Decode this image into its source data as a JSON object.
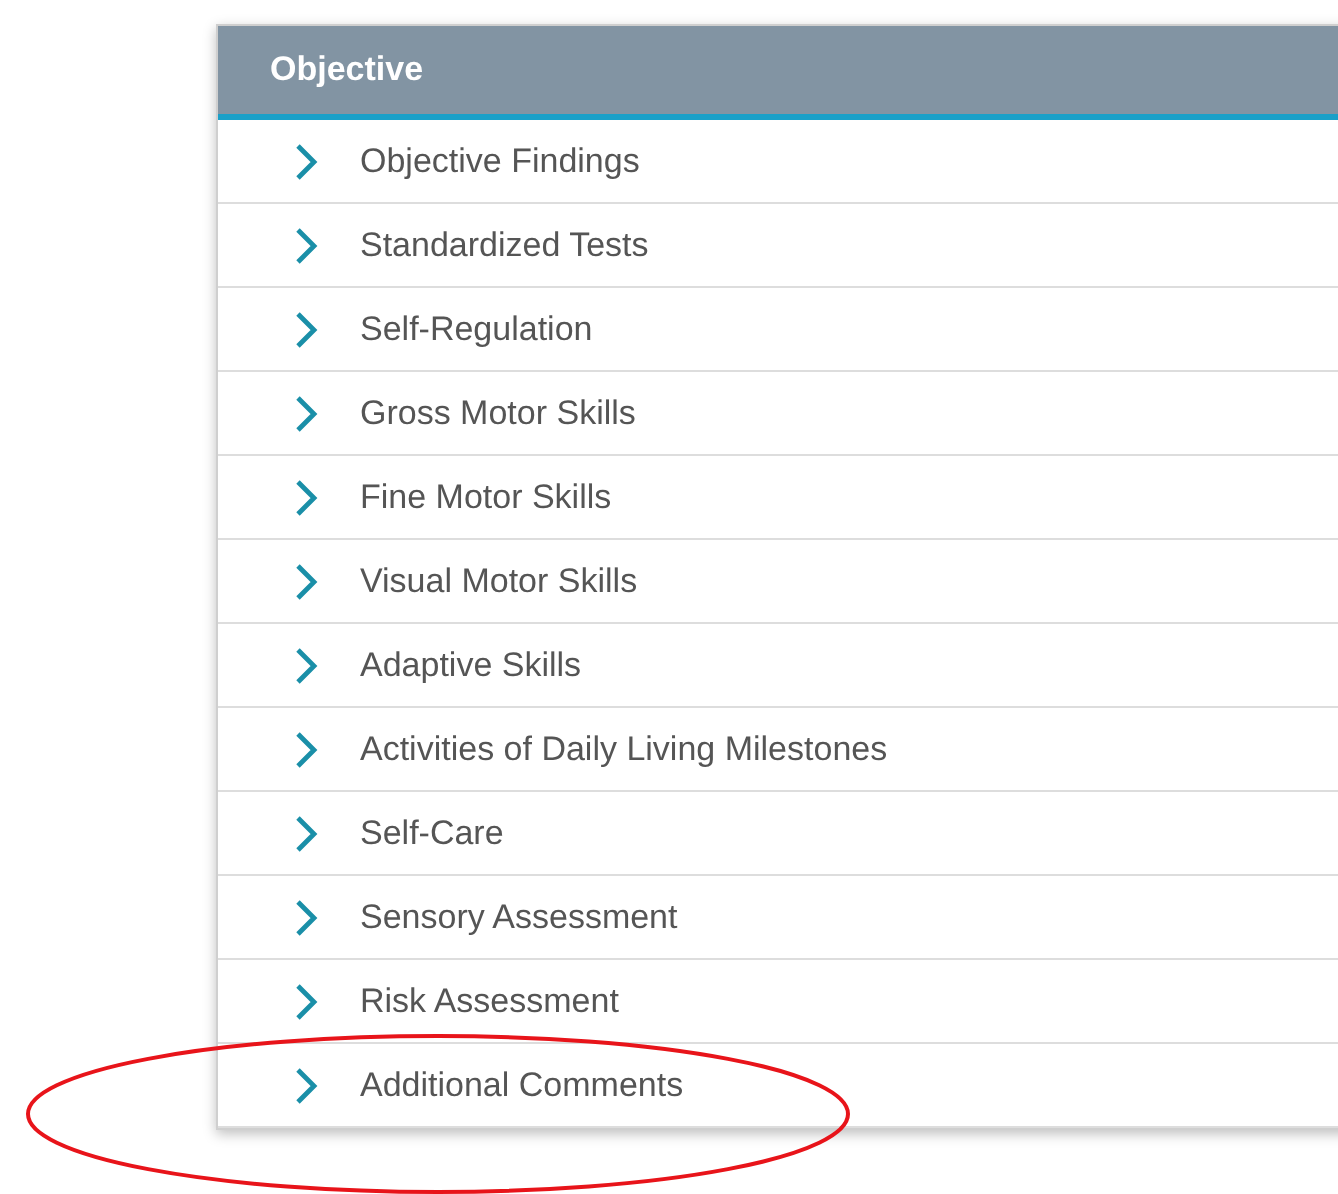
{
  "panel": {
    "title": "Objective",
    "items": [
      {
        "label": "Objective Findings",
        "highlighted": false
      },
      {
        "label": "Standardized Tests",
        "highlighted": false
      },
      {
        "label": "Self-Regulation",
        "highlighted": false
      },
      {
        "label": "Gross Motor Skills",
        "highlighted": false
      },
      {
        "label": "Fine Motor Skills",
        "highlighted": false
      },
      {
        "label": "Visual Motor Skills",
        "highlighted": false
      },
      {
        "label": "Adaptive Skills",
        "highlighted": false
      },
      {
        "label": "Activities of Daily Living Milestones",
        "highlighted": false
      },
      {
        "label": "Self-Care",
        "highlighted": false
      },
      {
        "label": "Sensory Assessment",
        "highlighted": false
      },
      {
        "label": "Risk Assessment",
        "highlighted": false
      },
      {
        "label": "Additional Comments",
        "highlighted": true
      }
    ]
  }
}
